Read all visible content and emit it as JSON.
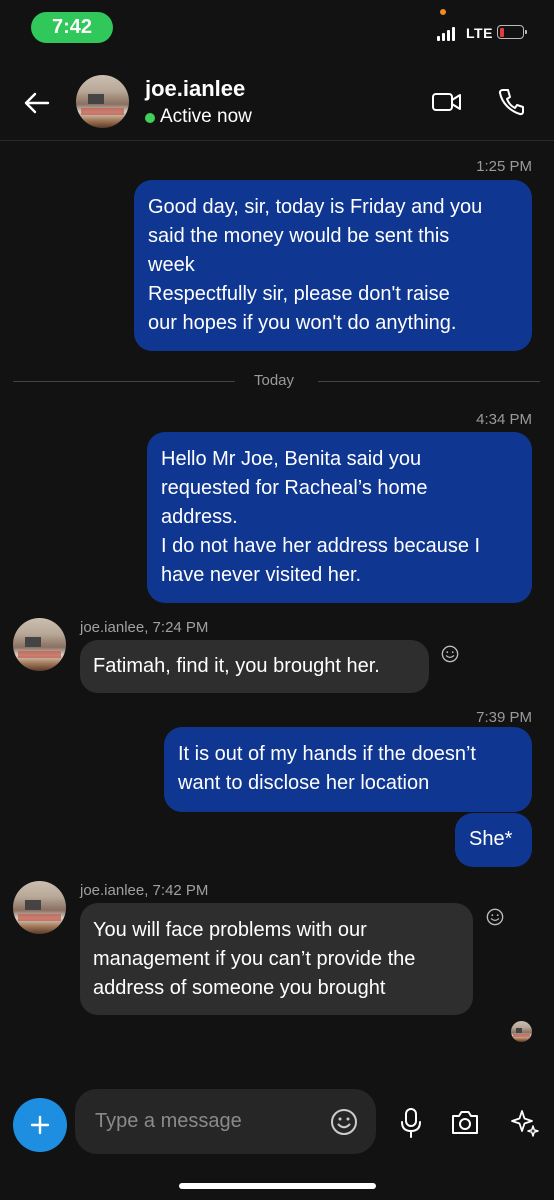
{
  "status_bar": {
    "time": "7:42",
    "network": "LTE"
  },
  "header": {
    "username": "joe.ianlee",
    "status": "Active now"
  },
  "messages": {
    "m1_time": "1:25 PM",
    "m1_text": "Good day, sir, today is Friday and you\nsaid the money would be sent this\nweek\nRespectfully sir, please don't raise\nour hopes if you won't do anything.",
    "divider": "Today",
    "m2_time": "4:34 PM",
    "m2_text": "Hello Mr Joe, Benita said you\nrequested for Racheal’s home\naddress.\nI do not have her address because I\nhave never visited her.",
    "m3_sender": "joe.ianlee, 7:24 PM",
    "m3_text": "Fatimah, find it, you brought her.",
    "m4_time": "7:39 PM",
    "m4_text": "It is out of my hands if the doesn’t\nwant to disclose her location",
    "m5_text": "She*",
    "m6_sender": "joe.ianlee, 7:42 PM",
    "m6_text": "You will face problems with our\nmanagement if you can’t provide the\naddress of someone you brought"
  },
  "composer": {
    "placeholder": "Type a message"
  },
  "colors": {
    "background": "#121212",
    "outgoing_bubble": "#0f3791",
    "incoming_bubble": "#2e2e2e",
    "accent": "#1e8fe0",
    "active": "#3fd15a"
  },
  "icons": {
    "back": "arrow-left-icon",
    "video": "video-camera-icon",
    "call": "phone-icon",
    "react": "smiley-icon",
    "add": "plus-icon",
    "emoji": "emoji-icon",
    "mic": "microphone-icon",
    "camera": "camera-icon",
    "ai": "sparkle-icon"
  }
}
